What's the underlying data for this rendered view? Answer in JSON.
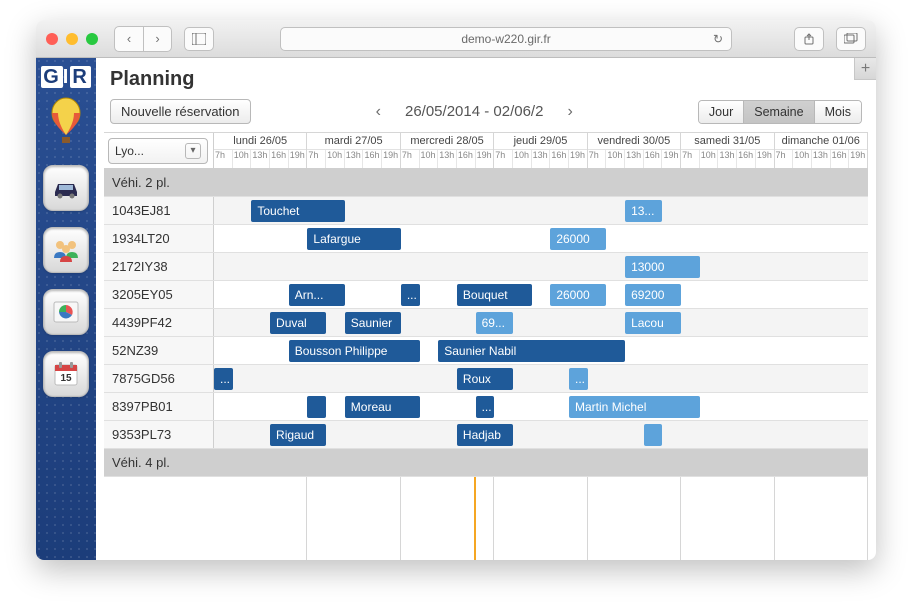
{
  "browser": {
    "url": "demo-w220.gir.fr"
  },
  "sidebar": {
    "brand_g": "G",
    "brand_i": "I",
    "brand_r": "R"
  },
  "page": {
    "title": "Planning",
    "new_reservation_label": "Nouvelle réservation",
    "date_range": "26/05/2014 - 02/06/2",
    "views": {
      "day": "Jour",
      "week": "Semaine",
      "month": "Mois"
    },
    "filter_value": "Lyo..."
  },
  "days": [
    {
      "label": "lundi 26/05"
    },
    {
      "label": "mardi 27/05"
    },
    {
      "label": "mercredi 28/05"
    },
    {
      "label": "jeudi 29/05"
    },
    {
      "label": "vendredi 30/05"
    },
    {
      "label": "samedi 31/05"
    },
    {
      "label": "dimanche 01/06"
    }
  ],
  "hours": [
    "7h",
    "10h",
    "13h",
    "16h",
    "19h"
  ],
  "rows": [
    {
      "type": "group",
      "label": "Véhi. 2 pl."
    },
    {
      "type": "res",
      "label": "1043EJ81",
      "events": [
        {
          "label": "Touchet",
          "style": "dark",
          "day": 0,
          "startSlot": 2,
          "span": 5
        },
        {
          "label": "13...",
          "style": "light",
          "day": 4,
          "startSlot": 2,
          "span": 2
        }
      ]
    },
    {
      "type": "res",
      "label": "1934LT20",
      "events": [
        {
          "label": "Lafargue",
          "style": "dark",
          "day": 1,
          "startSlot": 0,
          "span": 5
        },
        {
          "label": "26000",
          "style": "light",
          "day": 3,
          "startSlot": 3,
          "span": 3
        }
      ]
    },
    {
      "type": "res",
      "label": "2172IY38",
      "events": [
        {
          "label": "13000",
          "style": "light",
          "day": 4,
          "startSlot": 2,
          "span": 4
        }
      ]
    },
    {
      "type": "res",
      "label": "3205EY05",
      "events": [
        {
          "label": "Arn...",
          "style": "dark",
          "day": 0,
          "startSlot": 4,
          "span": 3
        },
        {
          "label": "...",
          "style": "dark",
          "day": 2,
          "startSlot": 0,
          "span": 1
        },
        {
          "label": "Bouquet",
          "style": "dark",
          "day": 2,
          "startSlot": 3,
          "span": 4
        },
        {
          "label": "26000",
          "style": "light",
          "day": 3,
          "startSlot": 3,
          "span": 3
        },
        {
          "label": "69200",
          "style": "light",
          "day": 4,
          "startSlot": 2,
          "span": 3
        }
      ]
    },
    {
      "type": "res",
      "label": "4439PF42",
      "events": [
        {
          "label": "Duval",
          "style": "dark",
          "day": 0,
          "startSlot": 3,
          "span": 3
        },
        {
          "label": "Saunier",
          "style": "dark",
          "day": 1,
          "startSlot": 2,
          "span": 3
        },
        {
          "label": "69...",
          "style": "light",
          "day": 2,
          "startSlot": 4,
          "span": 2
        },
        {
          "label": "Lacou",
          "style": "light",
          "day": 4,
          "startSlot": 2,
          "span": 3
        }
      ]
    },
    {
      "type": "res",
      "label": "52NZ39",
      "events": [
        {
          "label": "Bousson Philippe",
          "style": "dark",
          "day": 0,
          "startSlot": 4,
          "span": 7
        },
        {
          "label": "Saunier Nabil",
          "style": "dark",
          "day": 2,
          "startSlot": 2,
          "span": 10
        }
      ]
    },
    {
      "type": "res",
      "label": "7875GD56",
      "events": [
        {
          "label": "...",
          "style": "dark",
          "day": 0,
          "startSlot": 0,
          "span": 1
        },
        {
          "label": "Roux",
          "style": "dark",
          "day": 2,
          "startSlot": 3,
          "span": 3
        },
        {
          "label": "...",
          "style": "light",
          "day": 3,
          "startSlot": 4,
          "span": 1
        }
      ]
    },
    {
      "type": "res",
      "label": "8397PB01",
      "events": [
        {
          "label": "",
          "style": "dark",
          "day": 1,
          "startSlot": 0,
          "span": 1
        },
        {
          "label": "Moreau",
          "style": "dark",
          "day": 1,
          "startSlot": 2,
          "span": 4
        },
        {
          "label": "...",
          "style": "dark",
          "day": 2,
          "startSlot": 4,
          "span": 1
        },
        {
          "label": "Martin Michel",
          "style": "light",
          "day": 3,
          "startSlot": 4,
          "span": 7
        }
      ]
    },
    {
      "type": "res",
      "label": "9353PL73",
      "events": [
        {
          "label": "Rigaud",
          "style": "dark",
          "day": 0,
          "startSlot": 3,
          "span": 3
        },
        {
          "label": "Hadjab",
          "style": "dark",
          "day": 2,
          "startSlot": 3,
          "span": 3
        },
        {
          "label": "",
          "style": "light",
          "day": 4,
          "startSlot": 3,
          "span": 1
        }
      ]
    },
    {
      "type": "group",
      "label": "Véhi. 4 pl."
    }
  ]
}
